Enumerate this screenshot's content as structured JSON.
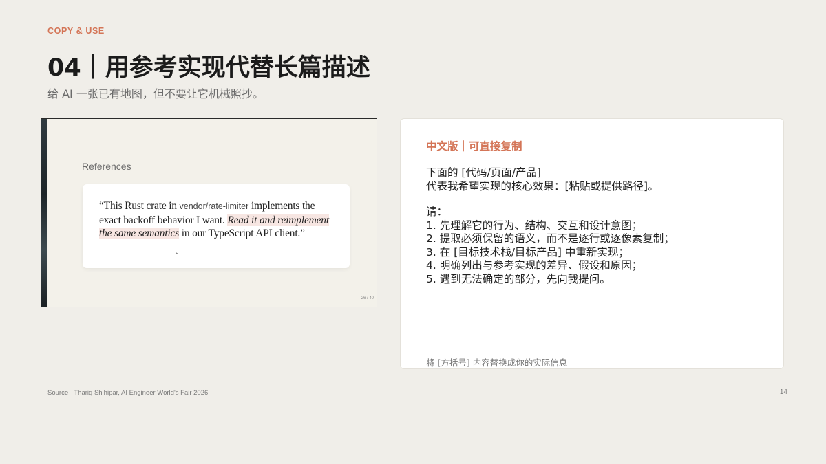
{
  "header": {
    "kicker": "COPY & USE",
    "title": "04｜用参考实现代替长篇描述",
    "subtitle": "给 AI 一张已有地图，但不要让它机械照抄。"
  },
  "slide": {
    "label": "References",
    "quote": {
      "part1": "“This Rust crate in ",
      "code": "vendor/rate-limiter",
      "part2": " implements the exact backoff behavior I want. ",
      "highlight": "Read it and reimplement the same semantics",
      "part3": " in our TypeScript API client.”"
    },
    "tick": "`",
    "page": "26 / 40"
  },
  "prompt": {
    "header": "中文版｜可直接复制",
    "lines": [
      "下面的 [代码/页面/产品]",
      "代表我希望实现的核心效果：[粘贴或提供路径]。"
    ],
    "request_label": "请：",
    "steps": [
      "1. 先理解它的行为、结构、交互和设计意图；",
      "2. 提取必须保留的语义，而不是逐行或逐像素复制；",
      "3. 在 [目标技术栈/目标产品] 中重新实现；",
      "4. 明确列出与参考实现的差异、假设和原因；",
      "5. 遇到无法确定的部分，先向我提问。"
    ],
    "footer": "将 [方括号] 内容替换成你的实际信息"
  },
  "footer": {
    "source": "Source · Thariq Shihipar, AI Engineer World's Fair 2026",
    "page": "14"
  },
  "colors": {
    "accent": "#d47557",
    "background": "#f0eee9",
    "highlight": "#f7e6e2"
  }
}
